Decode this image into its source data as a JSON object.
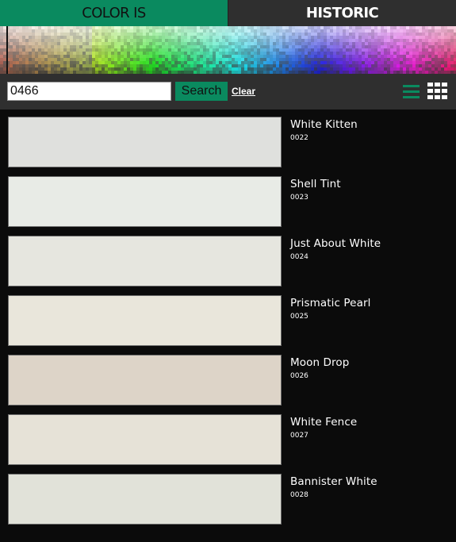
{
  "tabs": {
    "active_label": "COLOR IS",
    "inactive_label": "HISTORIC"
  },
  "search": {
    "value": "0466",
    "button_label": "Search",
    "clear_label": "Clear"
  },
  "colors": [
    {
      "name": "White Kitten",
      "code": "0022",
      "hex": "#dfe0dd"
    },
    {
      "name": "Shell Tint",
      "code": "0023",
      "hex": "#e8ebe6"
    },
    {
      "name": "Just About White",
      "code": "0024",
      "hex": "#e6e6df"
    },
    {
      "name": "Prismatic Pearl",
      "code": "0025",
      "hex": "#e9e6db"
    },
    {
      "name": "Moon Drop",
      "code": "0026",
      "hex": "#ddd4c8"
    },
    {
      "name": "White Fence",
      "code": "0027",
      "hex": "#e6e2d7"
    },
    {
      "name": "Bannister White",
      "code": "0028",
      "hex": "#e1e2d9"
    }
  ],
  "colors_theme": {
    "accent": "#0a8a5f",
    "toolbar_bg": "#2f2f2f",
    "list_bg": "#0b0b0b"
  }
}
